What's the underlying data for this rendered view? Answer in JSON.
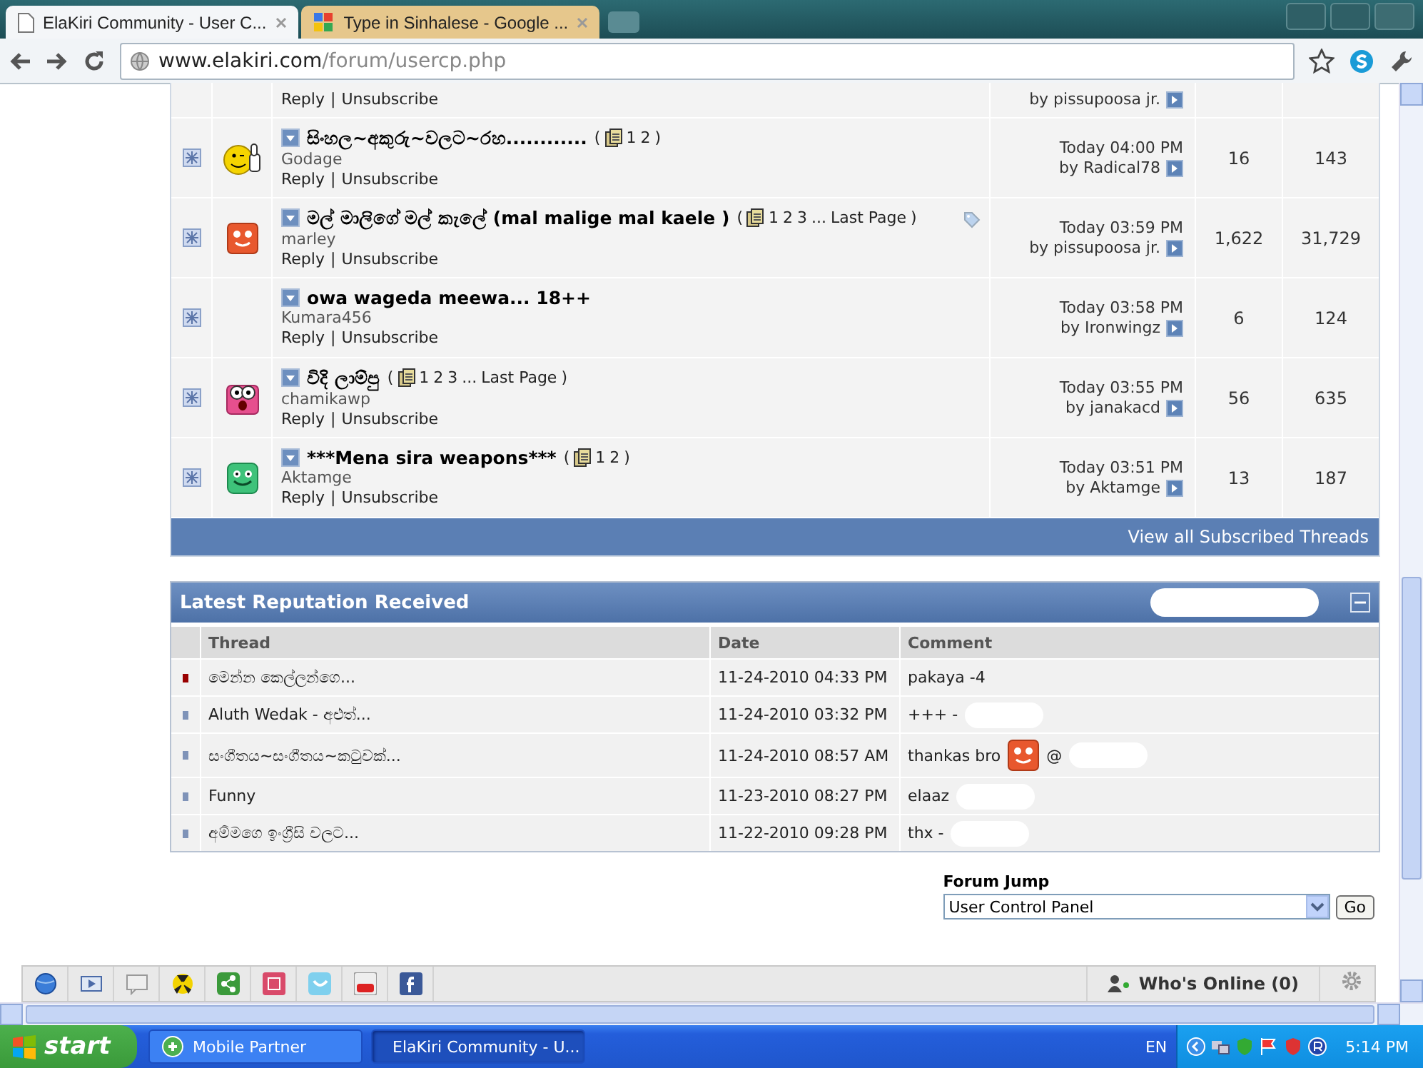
{
  "browser": {
    "tabs": [
      {
        "title": "ElaKiri Community - User C...",
        "selected": true
      },
      {
        "title": "Type in Sinhalese - Google ...",
        "selected": false
      }
    ],
    "url_host": "www.elakiri.com",
    "url_path": "/forum/usercp.php"
  },
  "subscribed_threads": {
    "rows": [
      {
        "kind": "partial",
        "actions": [
          "Reply",
          "Unsubscribe"
        ],
        "separator": "|",
        "last_post_by": "by pissupoosa jr."
      },
      {
        "kind": "full",
        "avatar": {
          "kind": "smiley-thumb"
        },
        "title": "සිංහල~අකුරු~වලට~රහ............",
        "pages": {
          "open": "(",
          "links": [
            "1",
            "2"
          ],
          "close": ")"
        },
        "tagged": false,
        "starter": "Godage",
        "actions": [
          "Reply",
          "Unsubscribe"
        ],
        "separator": "|",
        "last_post_time": "Today 04:00 PM",
        "last_post_by": "by Radical78",
        "replies": "16",
        "views": "143"
      },
      {
        "kind": "full",
        "avatar": {
          "kind": "orange-face"
        },
        "title": "මල් මාලිගේ මල් කැලේ (mal malige mal kaele )",
        "pages": {
          "open": "(",
          "links": [
            "1",
            "2",
            "3",
            "...",
            "Last Page"
          ],
          "close": ")"
        },
        "tagged": true,
        "starter": "marley",
        "actions": [
          "Reply",
          "Unsubscribe"
        ],
        "separator": "|",
        "last_post_time": "Today 03:59 PM",
        "last_post_by": "by pissupoosa jr.",
        "replies": "1,622",
        "views": "31,729"
      },
      {
        "kind": "full",
        "title": "owa wageda meewa... 18++",
        "tagged": false,
        "starter": "Kumara456",
        "actions": [
          "Reply",
          "Unsubscribe"
        ],
        "separator": "|",
        "last_post_time": "Today 03:58 PM",
        "last_post_by": "by Ironwingz",
        "replies": "6",
        "views": "124"
      },
      {
        "kind": "full",
        "avatar": {
          "kind": "pink-face"
        },
        "title": "විදි ලාම්පු",
        "pages": {
          "open": "(",
          "links": [
            "1",
            "2",
            "3",
            "...",
            "Last Page"
          ],
          "close": ")"
        },
        "tagged": false,
        "starter": "chamikawp",
        "actions": [
          "Reply",
          "Unsubscribe"
        ],
        "separator": "|",
        "last_post_time": "Today 03:55 PM",
        "last_post_by": "by janakacd",
        "replies": "56",
        "views": "635"
      },
      {
        "kind": "full",
        "avatar": {
          "kind": "green-face"
        },
        "title": "***Mena sira weapons***",
        "pages": {
          "open": "(",
          "links": [
            "1",
            "2"
          ],
          "close": ")"
        },
        "tagged": false,
        "starter": "Aktamge",
        "actions": [
          "Reply",
          "Unsubscribe"
        ],
        "separator": "|",
        "last_post_time": "Today 03:51 PM",
        "last_post_by": "by Aktamge",
        "replies": "13",
        "views": "187"
      }
    ],
    "footer_link": "View all Subscribed Threads"
  },
  "reputation": {
    "title": "Latest Reputation Received",
    "columns": [
      "Thread",
      "Date",
      "Comment"
    ],
    "rows": [
      {
        "color": "#990000",
        "thread": "මෙන්න කෙල්ලන්ගෙ...",
        "date": "11-24-2010 04:33 PM",
        "comment": "pakaya -4",
        "smiley": false,
        "redacted": false
      },
      {
        "color": "#7f93b8",
        "thread": "Aluth Wedak - අළුත්...",
        "date": "11-24-2010 03:32 PM",
        "comment": "+++ -",
        "smiley": false,
        "redacted": true
      },
      {
        "color": "#7f93b8",
        "thread": "සංගීතය~සංගීතය~කටුවක්...",
        "date": "11-24-2010 08:57 AM",
        "comment": "thankas bro",
        "smiley": true,
        "comment_after": "@",
        "redacted": true
      },
      {
        "color": "#7f93b8",
        "thread": "Funny",
        "date": "11-23-2010 08:27 PM",
        "comment": "elaaz",
        "smiley": false,
        "redacted": true
      },
      {
        "color": "#7f93b8",
        "thread": "අම්මගෙ ඉංග්‍රීසි වලට...",
        "date": "11-22-2010 09:28 PM",
        "comment": "thx -",
        "smiley": false,
        "redacted": true
      }
    ]
  },
  "forum_jump": {
    "label": "Forum Jump",
    "value": "User Control Panel",
    "button": "Go"
  },
  "addon_bar": {
    "whos_online": "Who's Online (0)"
  },
  "taskbar": {
    "start": "start",
    "tasks": [
      {
        "label": "Mobile Partner",
        "selected": false
      },
      {
        "label": "ElaKiri Community - U...",
        "selected": true
      }
    ],
    "language": "EN",
    "clock": "5:14 PM"
  }
}
